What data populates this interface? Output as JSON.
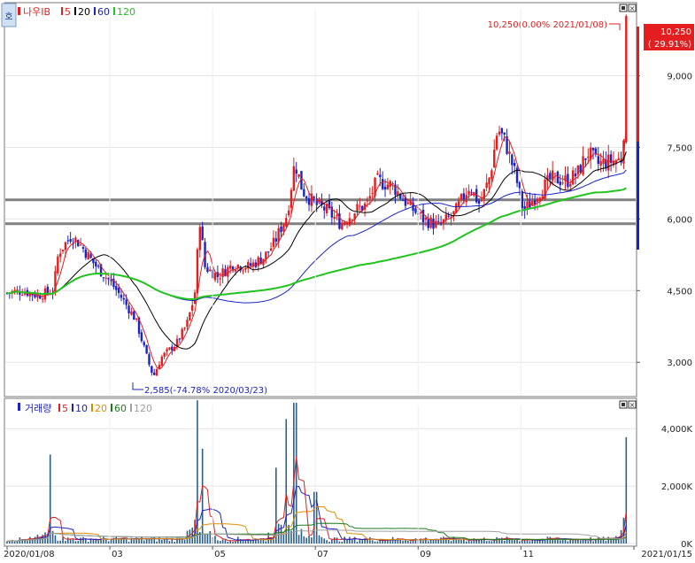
{
  "price_panel": {
    "stock_name": "나우IB",
    "ma_labels": [
      {
        "text": "5",
        "color": "#e41e1e"
      },
      {
        "text": "20",
        "color": "#000000"
      },
      {
        "text": "60",
        "color": "#1a22c8"
      },
      {
        "text": "120",
        "color": "#22c31e"
      }
    ],
    "high_annotation": "10,250(0.00% 2021/01/08)",
    "low_annotation": "2,585(-74.78% 2020/03/23)",
    "current_price": "10,250",
    "current_change": "( 29.91%)",
    "y_ticks": [
      {
        "value": 3000,
        "label": "3,000"
      },
      {
        "value": 4500,
        "label": "4,500"
      },
      {
        "value": 6000,
        "label": "6,000"
      },
      {
        "value": 7500,
        "label": "7,500"
      },
      {
        "value": 9000,
        "label": "9,000"
      }
    ],
    "corner_icon": "ho-icon"
  },
  "volume_panel": {
    "title": "거래량",
    "ma_labels": [
      {
        "text": "5",
        "color": "#e41e1e"
      },
      {
        "text": "10",
        "color": "#1a22c8"
      },
      {
        "text": "20",
        "color": "#e08c00"
      },
      {
        "text": "60",
        "color": "#1e7a1e"
      },
      {
        "text": "120",
        "color": "#a0a0a0"
      }
    ],
    "y_ticks": [
      {
        "value": 0,
        "label": "0K"
      },
      {
        "value": 2000,
        "label": "2,000K"
      },
      {
        "value": 4000,
        "label": "4,000K"
      }
    ]
  },
  "x_axis": {
    "labels": [
      {
        "month": 0,
        "label": "2020/01/08"
      },
      {
        "month": 2,
        "label": "03"
      },
      {
        "month": 4,
        "label": "05"
      },
      {
        "month": 6,
        "label": "07"
      },
      {
        "month": 8,
        "label": "09"
      },
      {
        "month": 10,
        "label": "11"
      },
      {
        "month": 12.2,
        "label": "2021/01/15"
      }
    ]
  },
  "colors": {
    "up": "#e41e1e",
    "down": "#1a22c8",
    "ma5": "#e41e1e",
    "ma20": "#000000",
    "ma60": "#1a22c8",
    "ma120": "#22c31e",
    "support_line": "#808080"
  },
  "chart_data": {
    "type": "line",
    "title": "나우IB",
    "x": [
      "2020-01-08",
      "2020-02",
      "2020-03",
      "2020-03-23",
      "2020-04",
      "2020-05",
      "2020-06",
      "2020-07",
      "2020-08",
      "2020-09",
      "2020-10",
      "2020-11",
      "2020-12",
      "2021-01-07",
      "2021-01-08"
    ],
    "series": [
      {
        "name": "5",
        "values": [
          4450,
          5300,
          4700,
          2700,
          4200,
          4700,
          6100,
          6300,
          6700,
          5900,
          6900,
          6200,
          7200,
          7300,
          10250
        ]
      },
      {
        "name": "20",
        "values": [
          4400,
          5000,
          4800,
          3200,
          4000,
          4600,
          5700,
          6300,
          6500,
          6100,
          6800,
          6600,
          7000,
          7100,
          7300
        ]
      },
      {
        "name": "60",
        "values": [
          4400,
          4600,
          4650,
          4200,
          4100,
          4300,
          4900,
          5600,
          6100,
          6100,
          6400,
          6600,
          6900,
          7000,
          7100
        ]
      },
      {
        "name": "120",
        "values": [
          4400,
          4500,
          4550,
          4450,
          4350,
          4400,
          4600,
          5100,
          5400,
          5600,
          6000,
          6300,
          6600,
          6700,
          6800
        ]
      }
    ],
    "horizontal_lines": [
      6400,
      5900
    ],
    "high": {
      "value": 10250,
      "date": "2021/01/08"
    },
    "low": {
      "value": 2585,
      "date": "2020/03/23"
    },
    "ylim": [
      2300,
      10400
    ],
    "volume": {
      "peaks_k": [
        {
          "x": "2020-01-30",
          "value": 3100
        },
        {
          "x": "2020-04-15",
          "value": 4800
        },
        {
          "x": "2020-06-10",
          "value": 4900
        },
        {
          "x": "2020-06-01",
          "value": 4300
        },
        {
          "x": "2021-01-08",
          "value": 3700
        }
      ],
      "ylim": [
        0,
        4500
      ]
    }
  }
}
